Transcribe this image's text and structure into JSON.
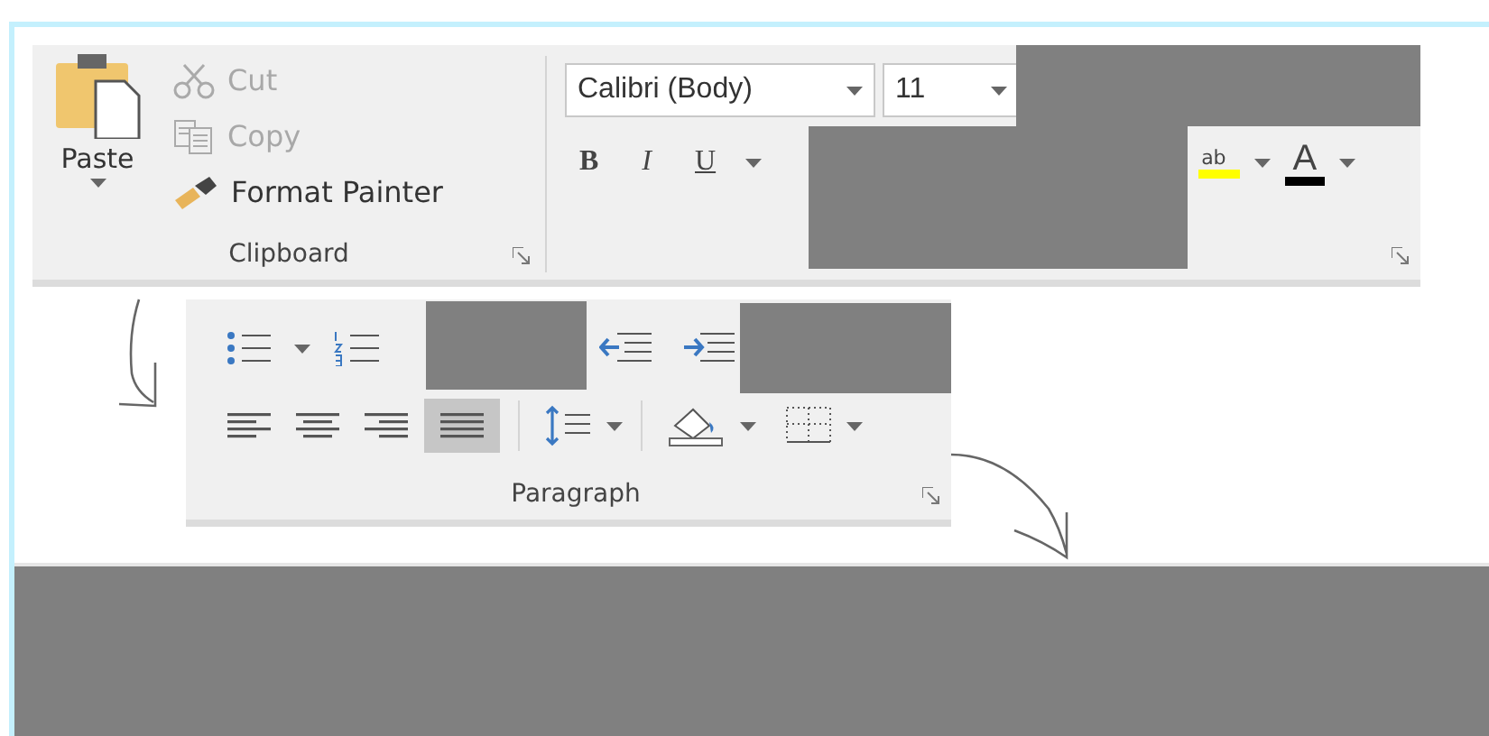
{
  "clipboard": {
    "title": "Clipboard",
    "paste": "Paste",
    "actions": [
      {
        "kind": "cut",
        "label": "Cut",
        "disabled": true
      },
      {
        "kind": "copy",
        "label": "Copy",
        "disabled": true
      },
      {
        "kind": "painter",
        "label": "Format Painter",
        "disabled": false
      }
    ]
  },
  "font": {
    "font_name": "Calibri (Body)",
    "font_size": "11",
    "styles": [
      {
        "kind": "bold",
        "label": "B"
      },
      {
        "kind": "italic",
        "label": "I"
      },
      {
        "kind": "underline",
        "label": "U"
      }
    ],
    "highlight_label": "ab",
    "color_label": "A"
  },
  "paragraph": {
    "title": "Paragraph",
    "alignments": [
      {
        "kind": "left",
        "selected": false
      },
      {
        "kind": "center",
        "selected": false
      },
      {
        "kind": "right",
        "selected": false
      },
      {
        "kind": "justify",
        "selected": true
      }
    ]
  }
}
